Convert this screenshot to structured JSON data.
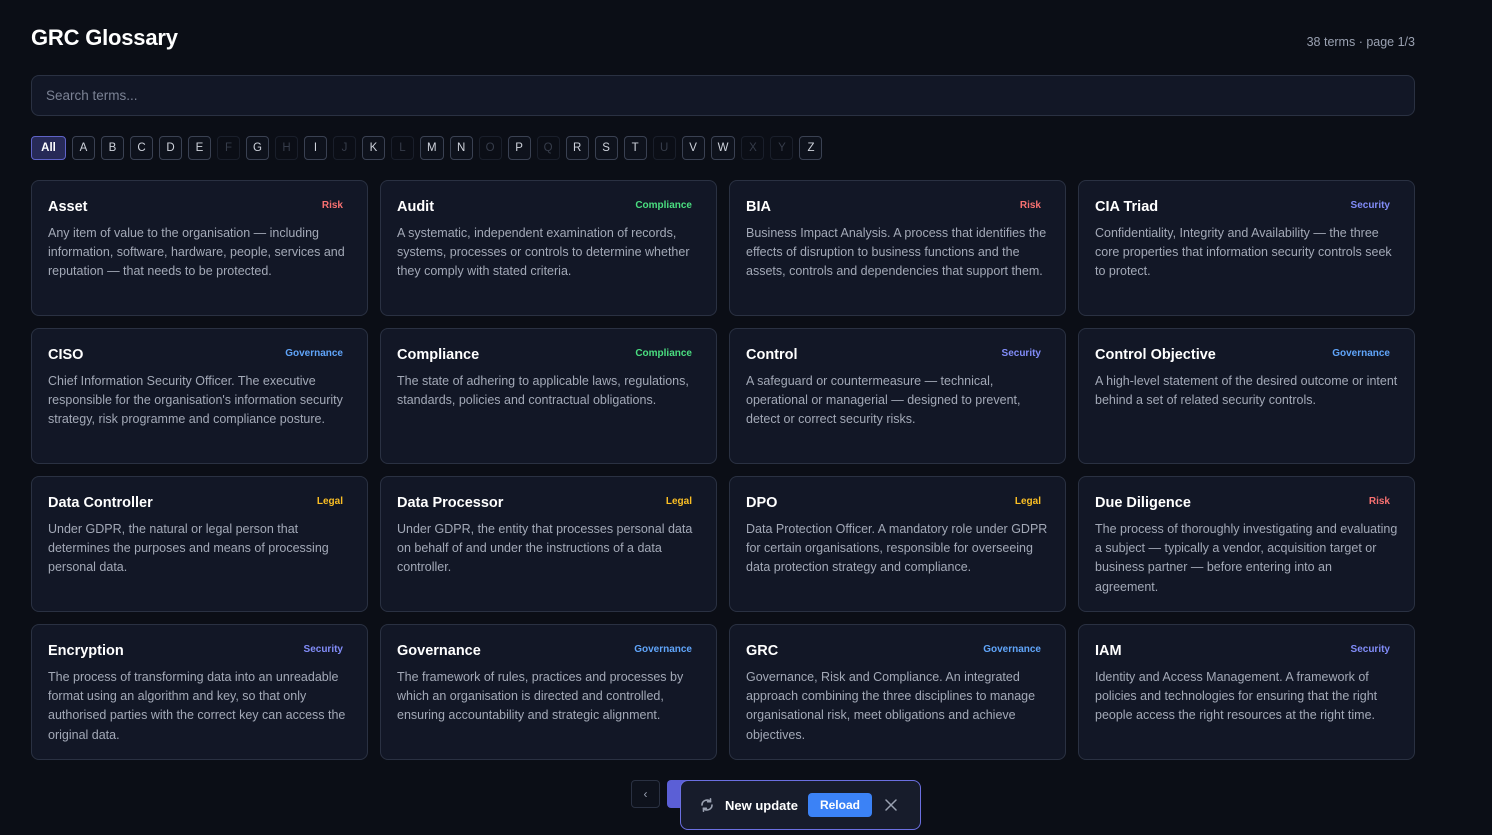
{
  "header": {
    "title": "GRC Glossary",
    "count": "38 terms · page 1/3"
  },
  "search": {
    "placeholder": "Search terms..."
  },
  "letters": [
    {
      "label": "All",
      "active": true
    },
    {
      "label": "A"
    },
    {
      "label": "B"
    },
    {
      "label": "C"
    },
    {
      "label": "D"
    },
    {
      "label": "E"
    },
    {
      "label": "F",
      "disabled": true
    },
    {
      "label": "G"
    },
    {
      "label": "H",
      "disabled": true
    },
    {
      "label": "I"
    },
    {
      "label": "J",
      "disabled": true
    },
    {
      "label": "K"
    },
    {
      "label": "L",
      "disabled": true
    },
    {
      "label": "M"
    },
    {
      "label": "N"
    },
    {
      "label": "O",
      "disabled": true
    },
    {
      "label": "P"
    },
    {
      "label": "Q",
      "disabled": true
    },
    {
      "label": "R"
    },
    {
      "label": "S"
    },
    {
      "label": "T"
    },
    {
      "label": "U",
      "disabled": true
    },
    {
      "label": "V"
    },
    {
      "label": "W"
    },
    {
      "label": "X",
      "disabled": true
    },
    {
      "label": "Y",
      "disabled": true
    },
    {
      "label": "Z"
    }
  ],
  "colors": {
    "Risk": "#f87171",
    "Compliance": "#4ade80",
    "Security": "#818cf8",
    "Governance": "#60a5fa",
    "Legal": "#fbbf24"
  },
  "cards": [
    {
      "term": "Asset",
      "category": "Risk",
      "definition": "Any item of value to the organisation — including information, software, hardware, people, services and reputation — that needs to be protected."
    },
    {
      "term": "Audit",
      "category": "Compliance",
      "definition": "A systematic, independent examination of records, systems, processes or controls to determine whether they comply with stated criteria."
    },
    {
      "term": "BIA",
      "category": "Risk",
      "definition": "Business Impact Analysis. A process that identifies the effects of disruption to business functions and the assets, controls and dependencies that support them."
    },
    {
      "term": "CIA Triad",
      "category": "Security",
      "definition": "Confidentiality, Integrity and Availability — the three core properties that information security controls seek to protect."
    },
    {
      "term": "CISO",
      "category": "Governance",
      "definition": "Chief Information Security Officer. The executive responsible for the organisation's information security strategy, risk programme and compliance posture."
    },
    {
      "term": "Compliance",
      "category": "Compliance",
      "definition": "The state of adhering to applicable laws, regulations, standards, policies and contractual obligations."
    },
    {
      "term": "Control",
      "category": "Security",
      "definition": "A safeguard or countermeasure — technical, operational or managerial — designed to prevent, detect or correct security risks."
    },
    {
      "term": "Control Objective",
      "category": "Governance",
      "definition": "A high-level statement of the desired outcome or intent behind a set of related security controls."
    },
    {
      "term": "Data Controller",
      "category": "Legal",
      "definition": "Under GDPR, the natural or legal person that determines the purposes and means of processing personal data."
    },
    {
      "term": "Data Processor",
      "category": "Legal",
      "definition": "Under GDPR, the entity that processes personal data on behalf of and under the instructions of a data controller."
    },
    {
      "term": "DPO",
      "category": "Legal",
      "definition": "Data Protection Officer. A mandatory role under GDPR for certain organisations, responsible for overseeing data protection strategy and compliance."
    },
    {
      "term": "Due Diligence",
      "category": "Risk",
      "definition": "The process of thoroughly investigating and evaluating a subject — typically a vendor, acquisition target or business partner — before entering into an agreement."
    },
    {
      "term": "Encryption",
      "category": "Security",
      "definition": "The process of transforming data into an unreadable format using an algorithm and key, so that only authorised parties with the correct key can access the original data."
    },
    {
      "term": "Governance",
      "category": "Governance",
      "definition": "The framework of rules, practices and processes by which an organisation is directed and controlled, ensuring accountability and strategic alignment."
    },
    {
      "term": "GRC",
      "category": "Governance",
      "definition": "Governance, Risk and Compliance. An integrated approach combining the three disciplines to manage organisational risk, meet obligations and achieve objectives."
    },
    {
      "term": "IAM",
      "category": "Security",
      "definition": "Identity and Access Management. A framework of policies and technologies for ensuring that the right people access the right resources at the right time."
    }
  ],
  "pager": {
    "prev": "‹"
  },
  "toast": {
    "icon": "refresh-icon",
    "message": "New update",
    "reload_label": "Reload",
    "close_icon": "close-icon"
  }
}
